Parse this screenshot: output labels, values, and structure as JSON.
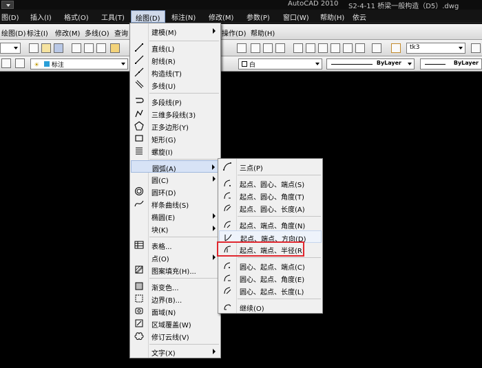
{
  "window": {
    "title_app": "AutoCAD 2010",
    "title_file": "S2-4-11 桥梁一般构造（D5）.dwg"
  },
  "menubar": {
    "items": [
      "图(D)",
      "插入(I)",
      "格式(O)",
      "工具(T)",
      "绘图(D)",
      "标注(N)",
      "修改(M)",
      "参数(P)",
      "窗口(W)",
      "帮助(H)",
      "依云"
    ],
    "active": "绘图(D)"
  },
  "toolbar_row1": {
    "left_items": [
      "绘图(D)",
      "标注(I)",
      "修改(M)",
      "多线(O)",
      "查询"
    ],
    "right_items": [
      "操作(D)",
      "帮助(H)"
    ]
  },
  "toolbar_row2": {
    "textstyle": "tk3"
  },
  "toolbar_row3": {
    "layer": "标注",
    "color": "白",
    "linetype": "ByLayer",
    "lineweight": "ByLayer"
  },
  "draw_menu": {
    "items": [
      {
        "label": "建模(M)",
        "icon": "none",
        "submenu": true
      },
      {
        "label": "直线(L)",
        "icon": "line-icon"
      },
      {
        "label": "射线(R)",
        "icon": "ray-icon"
      },
      {
        "label": "构造线(T)",
        "icon": "xline-icon"
      },
      {
        "label": "多线(U)",
        "icon": "mline-icon"
      },
      {
        "label": "多段线(P)",
        "icon": "polyline-icon"
      },
      {
        "label": "三维多段线(3)",
        "icon": "3dpoly-icon"
      },
      {
        "label": "正多边形(Y)",
        "icon": "polygon-icon"
      },
      {
        "label": "矩形(G)",
        "icon": "rectangle-icon"
      },
      {
        "label": "螺旋(I)",
        "icon": "helix-icon"
      },
      {
        "label": "圆弧(A)",
        "icon": "none",
        "submenu": true
      },
      {
        "label": "圆(C)",
        "icon": "none",
        "submenu": true
      },
      {
        "label": "圆环(D)",
        "icon": "donut-icon"
      },
      {
        "label": "样条曲线(S)",
        "icon": "spline-icon"
      },
      {
        "label": "椭圆(E)",
        "icon": "none",
        "submenu": true
      },
      {
        "label": "块(K)",
        "icon": "none",
        "submenu": true
      },
      {
        "label": "表格...",
        "icon": "table-icon"
      },
      {
        "label": "点(O)",
        "icon": "none",
        "submenu": true
      },
      {
        "label": "图案填充(H)...",
        "icon": "hatch-icon"
      },
      {
        "label": "渐变色...",
        "icon": "gradient-icon"
      },
      {
        "label": "边界(B)...",
        "icon": "boundary-icon"
      },
      {
        "label": "面域(N)",
        "icon": "region-icon"
      },
      {
        "label": "区域覆盖(W)",
        "icon": "wipeout-icon"
      },
      {
        "label": "修订云线(V)",
        "icon": "revcloud-icon"
      },
      {
        "label": "文字(X)",
        "icon": "none",
        "submenu": true
      }
    ],
    "highlighted": "圆弧(A)"
  },
  "arc_submenu": {
    "items": [
      {
        "label": "三点(P)",
        "icon": "arc-3point-icon"
      },
      {
        "label": "起点、圆心、端点(S)",
        "icon": "arc-sce-icon"
      },
      {
        "label": "起点、圆心、角度(T)",
        "icon": "arc-sca-icon"
      },
      {
        "label": "起点、圆心、长度(A)",
        "icon": "arc-scl-icon"
      },
      {
        "label": "起点、端点、角度(N)",
        "icon": "arc-sea-icon"
      },
      {
        "label": "起点、端点、方向(D)",
        "icon": "arc-sed-icon"
      },
      {
        "label": "起点、端点、半径(R)",
        "icon": "arc-ser-icon"
      },
      {
        "label": "圆心、起点、端点(C)",
        "icon": "arc-cse-icon"
      },
      {
        "label": "圆心、起点、角度(E)",
        "icon": "arc-csa-icon"
      },
      {
        "label": "圆心、起点、长度(L)",
        "icon": "arc-csl-icon"
      },
      {
        "label": "继续(O)",
        "icon": "arc-continue-icon"
      }
    ],
    "hovered": "起点、端点、方向(D)",
    "boxed": "起点、端点、半径(R)",
    "box_color": "#e0262d"
  }
}
